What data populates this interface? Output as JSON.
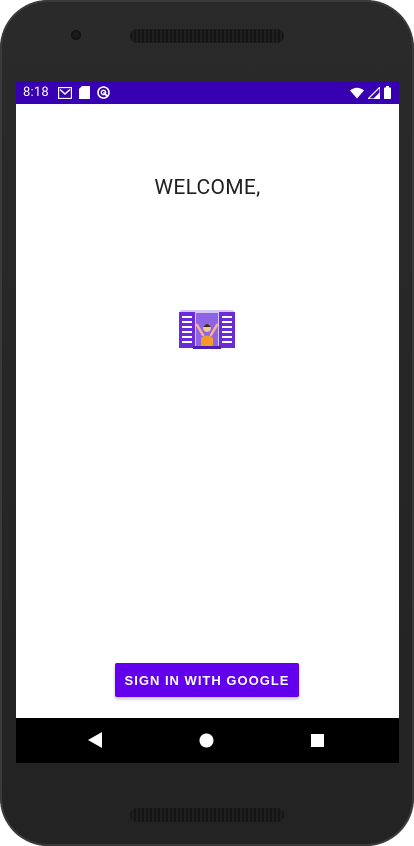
{
  "status_bar": {
    "time": "8:18",
    "background": "#3700b3",
    "left_icons": [
      "gmail-icon",
      "sd-card-icon",
      "sync-icon"
    ],
    "right_icons": [
      "wifi-icon",
      "signal-icon",
      "battery-icon"
    ]
  },
  "main": {
    "welcome_text": "WELCOME,",
    "illustration": "person-at-window-icon",
    "signin_label": "SIGN IN WITH GOOGLE",
    "button_color": "#6200ee"
  },
  "navigation": {
    "buttons": [
      "back-icon",
      "home-icon",
      "recents-icon"
    ]
  }
}
